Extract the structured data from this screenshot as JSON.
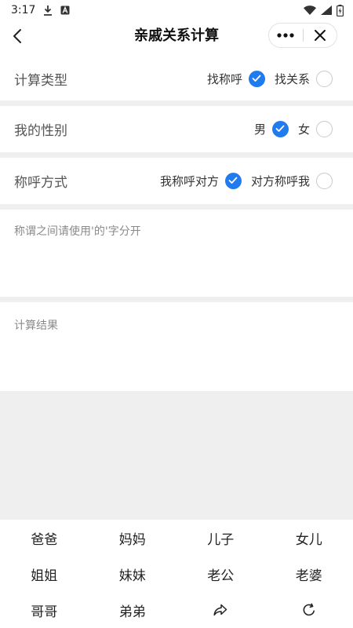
{
  "statusbar": {
    "time": "3:17"
  },
  "navbar": {
    "title": "亲戚关系计算"
  },
  "calc_type": {
    "label": "计算类型",
    "options": [
      {
        "text": "找称呼",
        "selected": true
      },
      {
        "text": "找关系",
        "selected": false
      }
    ]
  },
  "gender": {
    "label": "我的性别",
    "options": [
      {
        "text": "男",
        "selected": true
      },
      {
        "text": "女",
        "selected": false
      }
    ]
  },
  "call_mode": {
    "label": "称呼方式",
    "options": [
      {
        "text": "我称呼对方",
        "selected": true
      },
      {
        "text": "对方称呼我",
        "selected": false
      }
    ]
  },
  "input": {
    "placeholder": "称谓之间请使用'的'字分开"
  },
  "result": {
    "placeholder": "计算结果"
  },
  "keyboard": {
    "keys": [
      "爸爸",
      "妈妈",
      "儿子",
      "女儿",
      "姐姐",
      "妹妹",
      "老公",
      "老婆",
      "哥哥",
      "弟弟"
    ],
    "icon_keys": [
      "share-icon",
      "refresh-icon"
    ]
  },
  "colors": {
    "accent": "#1f7cf0",
    "divider": "#efefef"
  }
}
